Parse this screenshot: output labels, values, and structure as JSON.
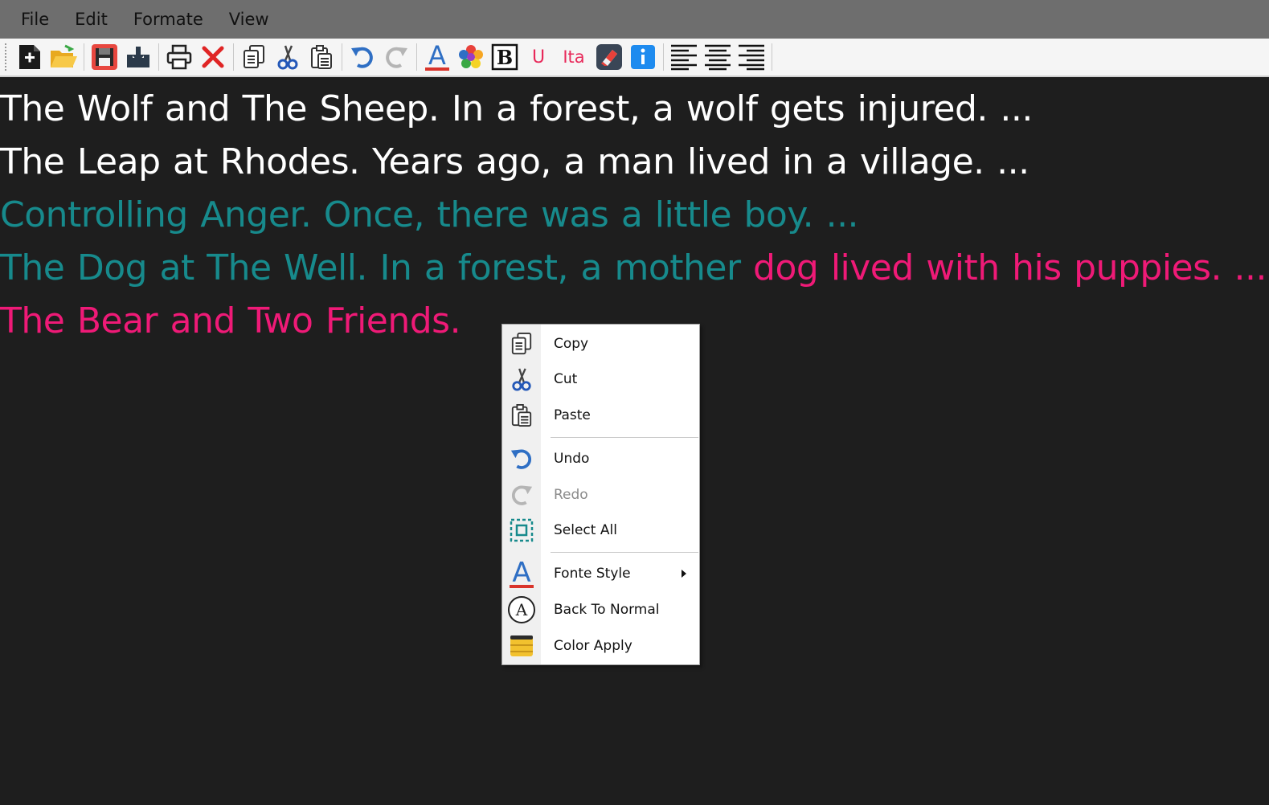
{
  "menubar": {
    "items": [
      "File",
      "Edit",
      "Formate",
      "View"
    ]
  },
  "toolbar": {
    "underline_label": "U",
    "italic_label": "Ita",
    "bold_label": "B",
    "font_color_label": "A",
    "buttons": [
      "new-icon",
      "open-folder-icon",
      "save-icon",
      "download-icon",
      "print-icon",
      "close-icon",
      "copy-icon",
      "cut-icon",
      "paste-icon",
      "undo-icon",
      "redo-icon",
      "font-color-icon",
      "color-picker-icon",
      "bold-icon",
      "underline-icon",
      "italic-icon",
      "eraser-icon",
      "info-icon",
      "align-left-icon",
      "align-center-icon",
      "align-right-icon"
    ]
  },
  "editor": {
    "lines": [
      {
        "segments": [
          {
            "text": "The Wolf and The Sheep. In a forest, a wolf gets injured. ...",
            "color": "#ffffff"
          }
        ]
      },
      {
        "segments": [
          {
            "text": "The Leap at Rhodes. Years ago, a man lived in a village. ...",
            "color": "#ffffff"
          }
        ]
      },
      {
        "segments": [
          {
            "text": "Controlling Anger. Once, there was a little boy. ...",
            "color": "#178a8c"
          }
        ]
      },
      {
        "segments": [
          {
            "text": "The Dog at The Well. In a forest, a mother ",
            "color": "#178a8c"
          },
          {
            "text": "dog lived with his puppies. ...",
            "color": "#ef1a77"
          }
        ]
      },
      {
        "segments": [
          {
            "text": "The Bear and Two Friends.",
            "color": "#ef1a77"
          }
        ]
      }
    ]
  },
  "context_menu": {
    "copy": "Copy",
    "cut": "Cut",
    "paste": "Paste",
    "undo": "Undo",
    "redo": "Redo",
    "select_all": "Select All",
    "fonte_style": "Fonte Style",
    "back_to_normal": "Back To Normal",
    "back_to_normal_icon_letter": "A",
    "color_apply": "Color Apply"
  },
  "colors": {
    "menubar_bg": "#6e6e6e",
    "editor_bg": "#1e1e1e",
    "teal_text": "#178a8c",
    "pink_text": "#ef1a77",
    "white_text": "#ffffff"
  }
}
